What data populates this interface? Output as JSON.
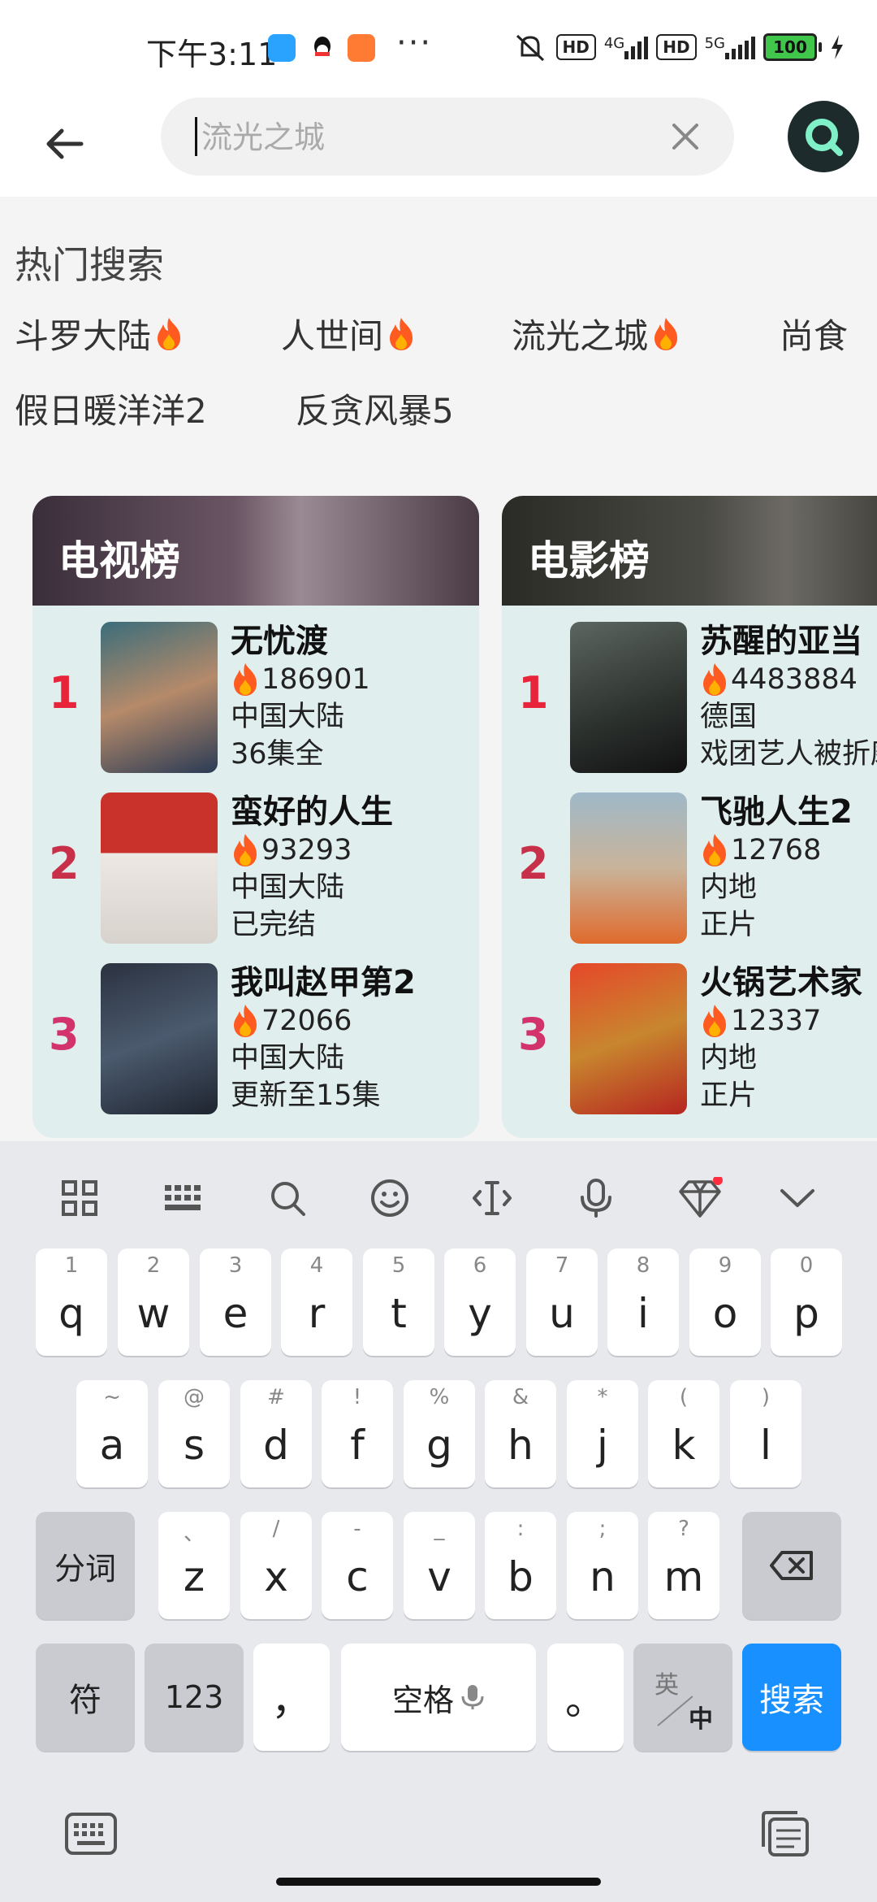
{
  "status_bar": {
    "time": "下午3:11",
    "dots": "···",
    "net1": "4G",
    "net2": "5G",
    "hd": "HD",
    "battery": "100"
  },
  "search": {
    "placeholder": "流光之城"
  },
  "hot_search": {
    "title": "热门搜索",
    "tags": [
      {
        "label": "斗罗大陆",
        "hot": true
      },
      {
        "label": "人世间",
        "hot": true
      },
      {
        "label": "流光之城",
        "hot": true
      },
      {
        "label": "尚食",
        "hot": false
      },
      {
        "label": "假日暖洋洋2",
        "hot": false
      },
      {
        "label": "反贪风暴5",
        "hot": false
      }
    ]
  },
  "tv_chart": {
    "title": "电视榜",
    "items": [
      {
        "rank": "1",
        "name": "无忧渡",
        "heat": "186901",
        "region": "中国大陆",
        "status": "36集全",
        "rank_color": "#e8243a",
        "poster": "poster-wuyoudu"
      },
      {
        "rank": "2",
        "name": "蛮好的人生",
        "heat": "93293",
        "region": "中国大陆",
        "status": "已完结",
        "rank_color": "#c8304a",
        "poster": "poster-manhao"
      },
      {
        "rank": "3",
        "name": "我叫赵甲第2",
        "heat": "72066",
        "region": "中国大陆",
        "status": "更新至15集",
        "rank_color": "#d2336b",
        "poster": "poster-zhaojiadi"
      }
    ]
  },
  "movie_chart": {
    "title": "电影榜",
    "items": [
      {
        "rank": "1",
        "name": "苏醒的亚当",
        "heat": "4483884",
        "region": "德国",
        "status": "戏团艺人被折磨",
        "rank_color": "#e8243a",
        "poster": "poster-adam"
      },
      {
        "rank": "2",
        "name": "飞驰人生2",
        "heat": "12768",
        "region": "内地",
        "status": "正片",
        "rank_color": "#c8304a",
        "poster": "poster-feichi"
      },
      {
        "rank": "3",
        "name": "火锅艺术家",
        "heat": "12337",
        "region": "内地",
        "status": "正片",
        "rank_color": "#d2336b",
        "poster": "poster-huoguo"
      }
    ]
  },
  "keyboard": {
    "row1": [
      {
        "k": "q",
        "s": "1"
      },
      {
        "k": "w",
        "s": "2"
      },
      {
        "k": "e",
        "s": "3"
      },
      {
        "k": "r",
        "s": "4"
      },
      {
        "k": "t",
        "s": "5"
      },
      {
        "k": "y",
        "s": "6"
      },
      {
        "k": "u",
        "s": "7"
      },
      {
        "k": "i",
        "s": "8"
      },
      {
        "k": "o",
        "s": "9"
      },
      {
        "k": "p",
        "s": "0"
      }
    ],
    "row2": [
      {
        "k": "a",
        "s": "~"
      },
      {
        "k": "s",
        "s": "@"
      },
      {
        "k": "d",
        "s": "#"
      },
      {
        "k": "f",
        "s": "!"
      },
      {
        "k": "g",
        "s": "%"
      },
      {
        "k": "h",
        "s": "&"
      },
      {
        "k": "j",
        "s": "*"
      },
      {
        "k": "k",
        "s": "("
      },
      {
        "k": "l",
        "s": ")"
      }
    ],
    "row3": [
      {
        "k": "z",
        "s": "、"
      },
      {
        "k": "x",
        "s": "/"
      },
      {
        "k": "c",
        "s": "-"
      },
      {
        "k": "v",
        "s": "_"
      },
      {
        "k": "b",
        "s": ":"
      },
      {
        "k": "n",
        "s": ";"
      },
      {
        "k": "m",
        "s": "?"
      }
    ],
    "fenci": "分词",
    "fu": "符",
    "num": "123",
    "comma": "，",
    "space": "空格",
    "period": "。",
    "lang_top": "英",
    "lang_bottom": "中",
    "search": "搜索"
  },
  "colors": {
    "accent_blue": "#1890ff",
    "fire": "#ff5a1f"
  }
}
